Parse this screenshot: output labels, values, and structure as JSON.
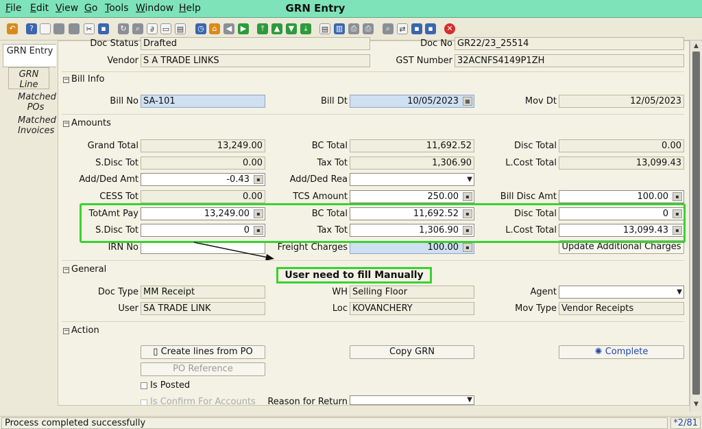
{
  "menu": {
    "items": [
      "File",
      "Edit",
      "View",
      "Go",
      "Tools",
      "Window",
      "Help"
    ],
    "mnemonics": [
      "F",
      "E",
      "V",
      "G",
      "T",
      "W",
      "H"
    ]
  },
  "window": {
    "title": "GRN Entry"
  },
  "tabs": {
    "grn_entry": "GRN Entry",
    "grn_line": "GRN Line",
    "matched_pos": "Matched POs",
    "matched_invoices": "Matched Invoices"
  },
  "header": {
    "doc_status_label": "Doc Status",
    "doc_status": "Drafted",
    "doc_no_label": "Doc No",
    "doc_no": "GR22/23_25514",
    "vendor_label": "Vendor",
    "vendor": "S A TRADE LINKS",
    "gst_label": "GST Number",
    "gst": "32ACNFS4149P1ZH"
  },
  "bill_info": {
    "section": "Bill Info",
    "bill_no_label": "Bill No",
    "bill_no": "SA-101",
    "bill_dt_label": "Bill Dt",
    "bill_dt": "10/05/2023",
    "mov_dt_label": "Mov Dt",
    "mov_dt": "12/05/2023"
  },
  "amounts": {
    "section": "Amounts",
    "grand_total_label": "Grand Total",
    "grand_total": "13,249.00",
    "bc_total_label": "BC Total",
    "bc_total": "11,692.52",
    "disc_total_label": "Disc Total",
    "disc_total": "0.00",
    "sdisc_tot_label": "S.Disc Tot",
    "sdisc_tot": "0.00",
    "tax_tot_label": "Tax Tot",
    "tax_tot": "1,306.90",
    "lcost_total_label": "L.Cost Total",
    "lcost_total": "13,099.43",
    "add_ded_amt_label": "Add/Ded Amt",
    "add_ded_amt": "-0.43",
    "add_ded_rea_label": "Add/Ded Rea",
    "add_ded_rea": "",
    "cess_tot_label": "CESS Tot",
    "cess_tot": "0.00",
    "tcs_amount_label": "TCS Amount",
    "tcs_amount": "250.00",
    "bill_disc_amt_label": "Bill Disc Amt",
    "bill_disc_amt": "100.00",
    "totamt_pay_label": "TotAmt Pay",
    "totamt_pay": "13,249.00",
    "bc_total2_label": "BC Total",
    "bc_total2": "11,692.52",
    "disc_total2_label": "Disc Total",
    "disc_total2": "0",
    "sdisc_tot2_label": "S.Disc Tot",
    "sdisc_tot2": "0",
    "tax_tot2_label": "Tax Tot",
    "tax_tot2": "1,306.90",
    "lcost_total2_label": "L.Cost Total",
    "lcost_total2": "13,099.43",
    "irn_no_label": "IRN No",
    "irn_no": "",
    "freight_label": "Freight Charges",
    "freight": "100.00",
    "update_charges_button": "Update Additional Charges"
  },
  "general": {
    "section": "General",
    "doc_type_label": "Doc Type",
    "doc_type": "MM Receipt",
    "wh_label": "WH",
    "wh": "Selling Floor",
    "agent_label": "Agent",
    "agent": "",
    "user_label": "User",
    "user": "SA TRADE LINK",
    "loc_label": "Loc",
    "loc": "KOVANCHERY",
    "mov_type_label": "Mov Type",
    "mov_type": "Vendor Receipts"
  },
  "action": {
    "section": "Action",
    "create_lines_button": "Create lines from PO",
    "copy_grn_button": "Copy GRN",
    "complete_button": "Complete",
    "po_reference_button": "PO Reference",
    "is_posted_label": "Is Posted",
    "is_confirm_label": "Is Confirm For Accounts",
    "reason_return_label": "Reason for Return"
  },
  "annotation": {
    "callout": "User need to fill Manually"
  },
  "status": {
    "message": "Process completed successfully",
    "page": "*2/81"
  },
  "colors": {
    "menubar": "#7ee3b8",
    "highlight": "#37d22f",
    "required_field": "#cfe0f2"
  }
}
